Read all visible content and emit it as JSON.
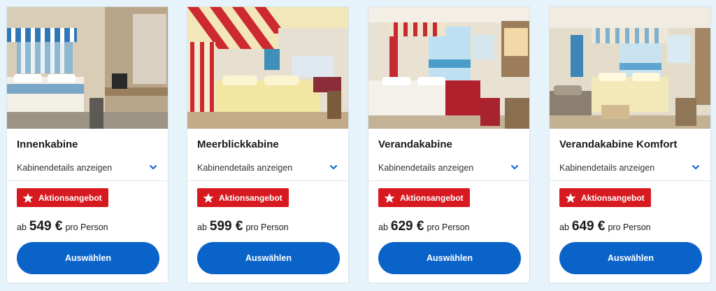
{
  "cabins": [
    {
      "title": "Innenkabine",
      "details_label": "Kabinendetails anzeigen",
      "badge_label": "Aktionsangebot",
      "price_prefix": "ab",
      "price": "549 €",
      "price_suffix": "pro Person",
      "button_label": "Auswählen"
    },
    {
      "title": "Meerblickkabine",
      "details_label": "Kabinendetails anzeigen",
      "badge_label": "Aktionsangebot",
      "price_prefix": "ab",
      "price": "599 €",
      "price_suffix": "pro Person",
      "button_label": "Auswählen"
    },
    {
      "title": "Verandakabine",
      "details_label": "Kabinendetails anzeigen",
      "badge_label": "Aktionsangebot",
      "price_prefix": "ab",
      "price": "629 €",
      "price_suffix": "pro Person",
      "button_label": "Auswählen"
    },
    {
      "title": "Verandakabine Komfort",
      "details_label": "Kabinendetails anzeigen",
      "badge_label": "Aktionsangebot",
      "price_prefix": "ab",
      "price": "649 €",
      "price_suffix": "pro Person",
      "button_label": "Auswählen"
    }
  ],
  "colors": {
    "page_background": "#e6f3fb",
    "accent_blue": "#0a63c9",
    "badge_red": "#d71920"
  },
  "icons": {
    "chevron": "chevron-down-icon",
    "badge": "star-icon"
  }
}
